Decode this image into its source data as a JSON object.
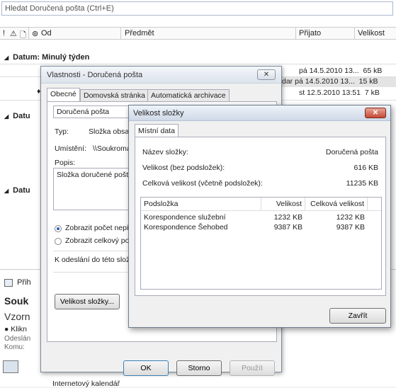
{
  "outlook": {
    "search_placeholder": "Hledat Doručená pošta (Ctrl+E)",
    "columns": {
      "from": "Od",
      "subject": "Předmět",
      "received": "Přijato",
      "size": "Velikost"
    },
    "group1_title": "Datum: Minulý týden",
    "group2_title": "Datu",
    "group3_title": "Datu",
    "rows": [
      {
        "received": "pá 14.5.2010 13...",
        "size": "65 kB",
        "subject_tail": ""
      },
      {
        "received": "pá 14.5.2010 13...",
        "size": "15 kB",
        "subject_tail": "dar"
      },
      {
        "received": "st 12.5.2010 13:51",
        "size": "7 kB",
        "subject_tail": ""
      }
    ],
    "preview": {
      "calendar_label": "Přih",
      "sender": "Souk",
      "subject": "Vzorn",
      "info": "Klikn",
      "sent": "Odeslán",
      "to": "Komu:",
      "footer": "Internetový kalendář"
    }
  },
  "props_dialog": {
    "title": "Vlastnosti - Doručená pošta",
    "close": "✕",
    "tabs": [
      "Obecné",
      "Domovská stránka",
      "Automatická archivace"
    ],
    "folder_name": "Doručená pošta",
    "type_label": "Typ:",
    "type_value": "Složka obsah",
    "location_label": "Umístění:",
    "location_value": "\\\\Soukromá p",
    "description_label": "Popis:",
    "description_value": "Složka doručené pošty",
    "radio1": "Zobrazit počet nepře",
    "radio2": "Zobrazit celkový poč",
    "send_label": "K odeslání do této složky",
    "folder_size_button": "Velikost složky...",
    "ok": "OK",
    "cancel": "Storno",
    "apply": "Použít"
  },
  "size_dialog": {
    "title": "Velikost složky",
    "close": "✕",
    "tab": "Místní data",
    "name_label": "Název složky:",
    "name_value": "Doručená pošta",
    "size_label": "Velikost (bez podsložek):",
    "size_value": "616 KB",
    "total_label": "Celková velikost (včetně podsložek):",
    "total_value": "11235 KB",
    "table_headers": {
      "subfolder": "Podsložka",
      "size": "Velikost",
      "total": "Celková velikost"
    },
    "rows": [
      {
        "name": "Korespondence služební",
        "size": "1232 KB",
        "total": "1232 KB"
      },
      {
        "name": "Korespondence Šehobed",
        "size": "9387 KB",
        "total": "9387 KB"
      }
    ],
    "close_button": "Zavřít"
  }
}
